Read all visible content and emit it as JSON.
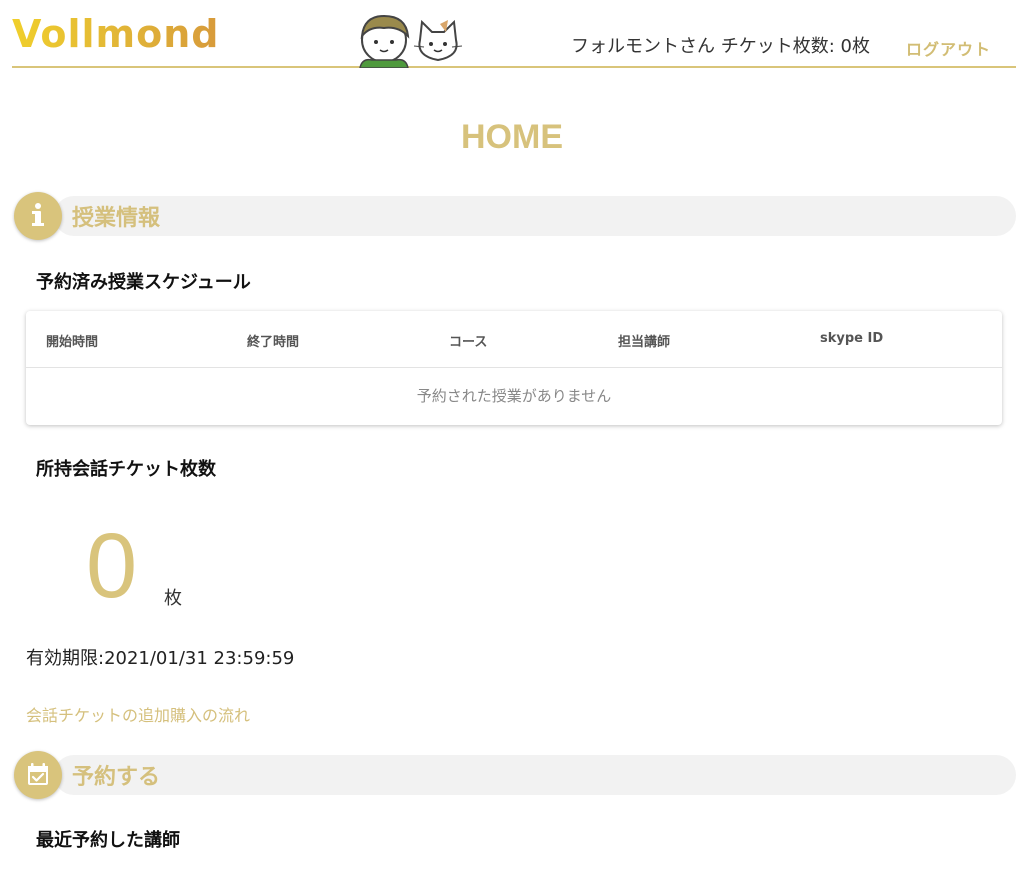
{
  "header": {
    "logo": "Vollmond",
    "user_info": "フォルモントさん チケット枚数: 0枚",
    "logout": "ログアウト"
  },
  "page_title": "HOME",
  "lesson_info": {
    "title": "授業情報",
    "icon": "info-icon",
    "schedule_heading": "予約済み授業スケジュール",
    "table": {
      "columns": [
        "開始時間",
        "終了時間",
        "コース",
        "担当講師",
        "skype ID"
      ],
      "empty_text": "予約された授業がありません"
    },
    "tickets_heading": "所持会話チケット枚数",
    "ticket_count": "0",
    "ticket_unit": "枚",
    "expiry": "有効期限:2021/01/31 23:59:59",
    "purchase_link": "会話チケットの追加購入の流れ"
  },
  "reserve": {
    "title": "予約する",
    "icon": "calendar-check-icon",
    "recent_heading": "最近予約した講師"
  },
  "colors": {
    "accent": "#d9c47c",
    "section_bg": "#f2f2f2",
    "logo_yellow": "#f0cf2c"
  }
}
